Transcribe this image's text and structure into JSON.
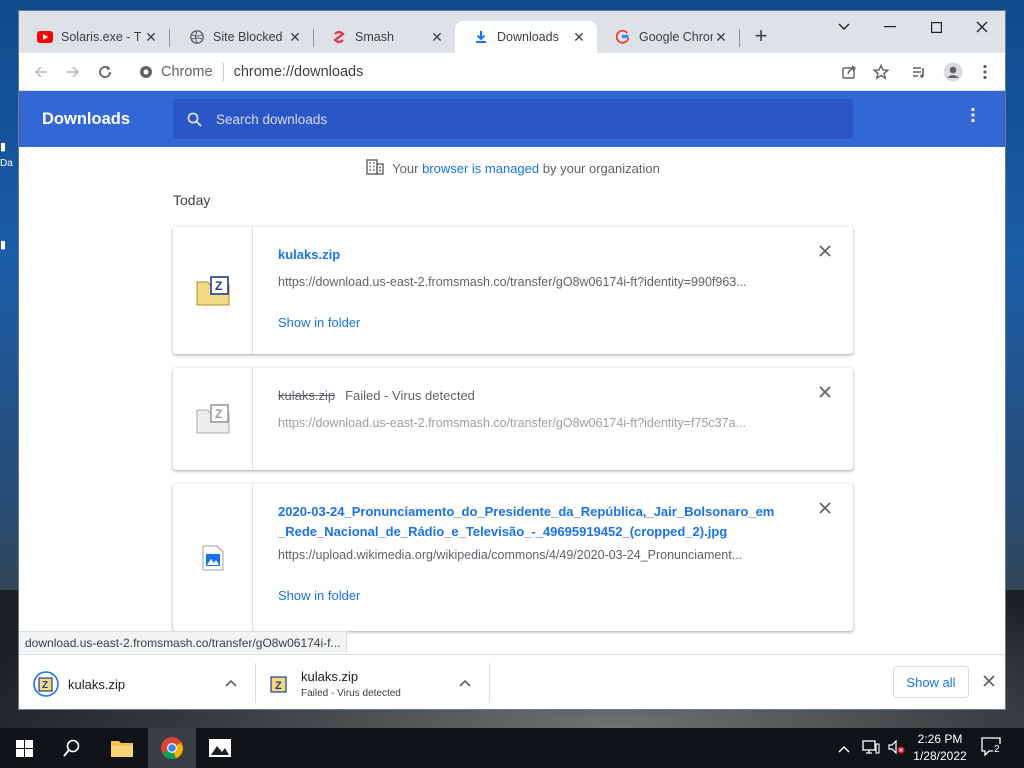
{
  "tabs": [
    {
      "title": "Solaris.exe - T",
      "favicon": "youtube-icon",
      "active": false
    },
    {
      "title": "Site Blocked",
      "favicon": "globe-icon",
      "active": false
    },
    {
      "title": "Smash",
      "favicon": "smash-icon",
      "active": false
    },
    {
      "title": "Downloads",
      "favicon": "download-icon",
      "active": true
    },
    {
      "title": "Google Chrom",
      "favicon": "google-icon",
      "active": false
    }
  ],
  "omnibox": {
    "site": "Chrome",
    "url": "chrome://downloads"
  },
  "downloads_page": {
    "title": "Downloads",
    "search_placeholder": "Search downloads",
    "managed": {
      "prefix": "Your ",
      "link": "browser is managed",
      "suffix": " by your organization"
    },
    "section": "Today",
    "items": [
      {
        "name": "kulaks.zip",
        "status": "",
        "source": "https://download.us-east-2.fromsmash.co/transfer/gO8w06174i-ft?identity=990f963...",
        "action": "Show in folder",
        "icon": "zip-file-icon",
        "failed": false
      },
      {
        "name": "kulaks.zip",
        "status": "Failed - Virus detected",
        "source": "https://download.us-east-2.fromsmash.co/transfer/gO8w06174i-ft?identity=f75c37a...",
        "action": "",
        "icon": "zip-file-icon",
        "failed": true
      },
      {
        "name": "2020-03-24_Pronunciamento_do_Presidente_da_República,_Jair_Bolsonaro_em_Rede_Nacional_de_Rádio_e_Televisão_-_49695919452_(cropped_2).jpg",
        "status": "",
        "source": "https://upload.wikimedia.org/wikipedia/commons/4/49/2020-03-24_Pronunciament...",
        "action": "Show in folder",
        "icon": "image-file-icon",
        "failed": false
      }
    ]
  },
  "status_url": "download.us-east-2.fromsmash.co/transfer/gO8w06174i-f...",
  "shelf": {
    "items": [
      {
        "name": "kulaks.zip",
        "status": ""
      },
      {
        "name": "kulaks.zip",
        "status": "Failed - Virus detected"
      }
    ],
    "show_all": "Show all"
  },
  "taskbar": {
    "time": "2:26 PM",
    "date": "1/28/2022",
    "notifications": "2"
  },
  "colors": {
    "accent": "#3367d6",
    "link": "#1a73e8"
  }
}
